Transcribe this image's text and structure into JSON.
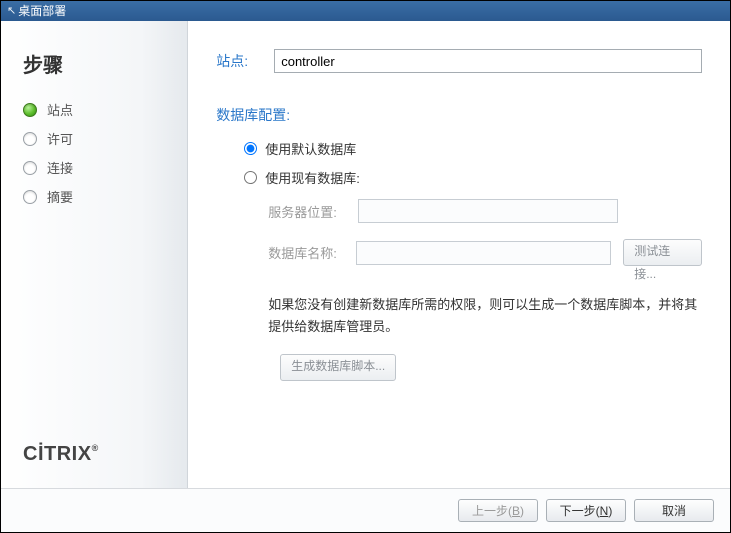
{
  "window": {
    "title": "桌面部署"
  },
  "sidebar": {
    "heading": "步骤",
    "brand": "CİTRIX",
    "steps": [
      {
        "label": "站点",
        "active": true
      },
      {
        "label": "许可",
        "active": false
      },
      {
        "label": "连接",
        "active": false
      },
      {
        "label": "摘要",
        "active": false
      }
    ]
  },
  "main": {
    "site_label": "站点:",
    "site_value": "controller",
    "db_section_title": "数据库配置:",
    "radio_default": "使用默认数据库",
    "radio_existing": "使用现有数据库:",
    "selected_radio": "default",
    "server_location_label": "服务器位置:",
    "server_location_value": "",
    "db_name_label": "数据库名称:",
    "db_name_value": "",
    "test_connection_label": "测试连接...",
    "info_text": "如果您没有创建新数据库所需的权限，则可以生成一个数据库脚本，并将其提供给数据库管理员。",
    "generate_script_label": "生成数据库脚本..."
  },
  "footer": {
    "back": "上一步(B)",
    "back_mnemonic": "B",
    "back_prefix": "上一步(",
    "back_suffix": ")",
    "next": "下一步(N)",
    "next_mnemonic": "N",
    "next_prefix": "下一步(",
    "next_suffix": ")",
    "cancel": "取消"
  }
}
